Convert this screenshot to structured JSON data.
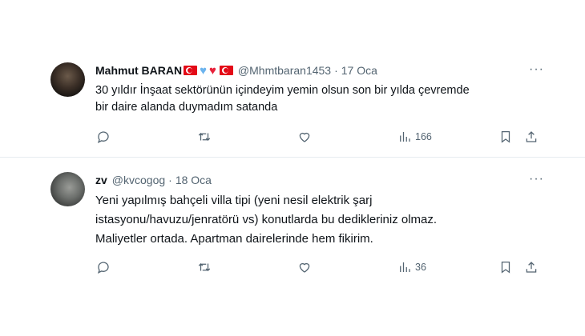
{
  "tweets": [
    {
      "name": "Mahmut BARAN",
      "emoji": [
        "turkish-flag-emoji",
        "blue-heart-emoji",
        "red-heart-emoji",
        "turkish-flag-emoji"
      ],
      "handle": "@Mhmtbaran1453",
      "dot": "·",
      "date": "17 Oca",
      "more": "···",
      "text_lines": [
        "30 yıldır İnşaat sektörünün içindeyim yemin olsun son bir yılda çevremde",
        "bir daire alanda duymadım satanda"
      ],
      "views": "166"
    },
    {
      "name": "zv",
      "handle": "@kvcogog",
      "dot": "·",
      "date": "18 Oca",
      "more": "···",
      "text_lines": [
        "Yeni yapılmış bahçeli villa tipi (yeni nesil elektrik şarj",
        "istasyonu/havuzu/jenratörü vs) konutlarda bu dedikleriniz olmaz.",
        "Maliyetler ortada. Apartman dairelerinde hem fikirim."
      ],
      "views": "36"
    }
  ],
  "icons": {
    "reply": "reply-icon",
    "retweet": "retweet-icon",
    "like": "like-icon",
    "views": "views-icon",
    "bookmark": "bookmark-icon",
    "share": "share-icon"
  },
  "colors": {
    "text": "#0f1419",
    "secondary": "#536471",
    "flag_red": "#e30a17",
    "blue_heart": "#6cb4ee",
    "red_heart": "#e8213a"
  }
}
